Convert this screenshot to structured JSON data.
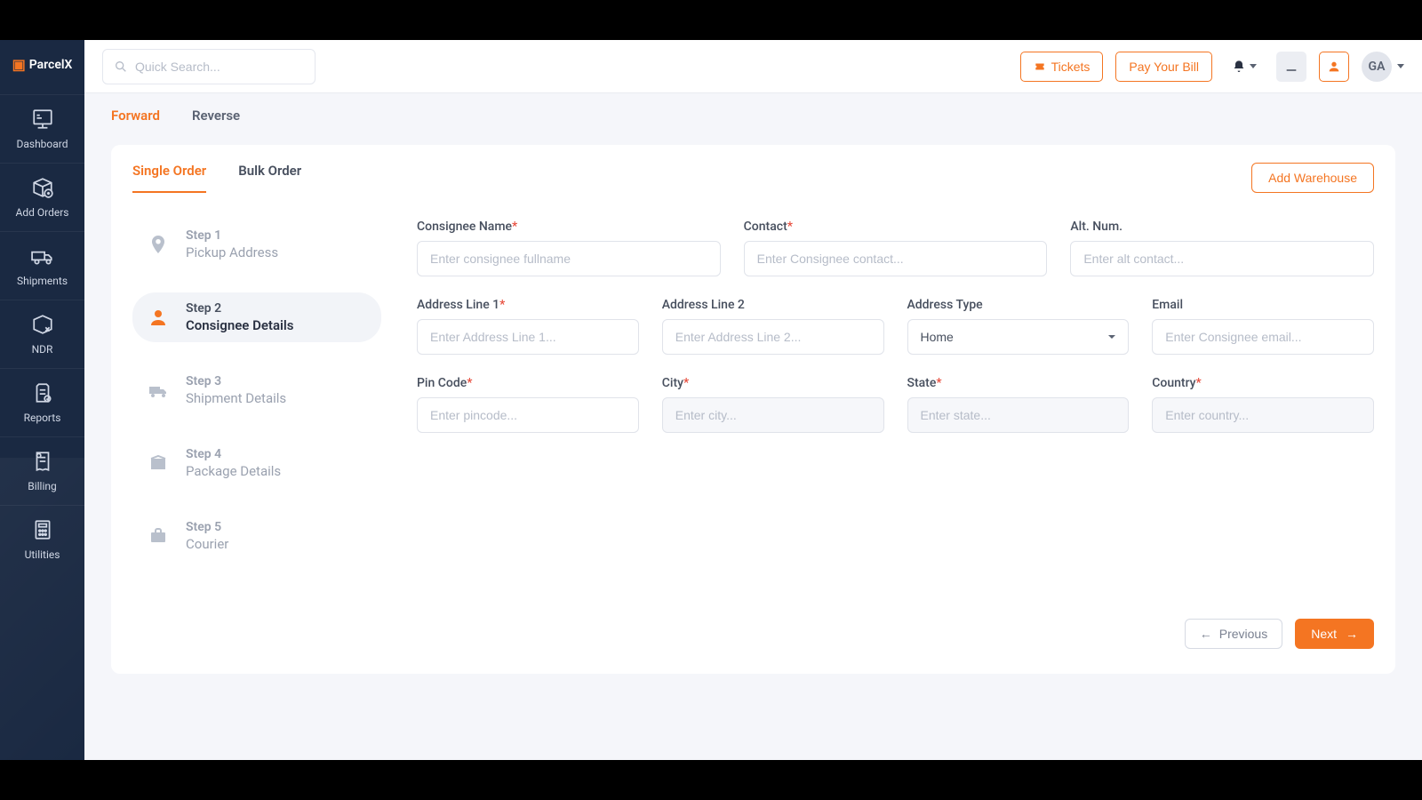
{
  "brand": {
    "name": "ParcelX"
  },
  "sidebar": {
    "items": [
      {
        "label": "Dashboard"
      },
      {
        "label": "Add Orders"
      },
      {
        "label": "Shipments"
      },
      {
        "label": "NDR"
      },
      {
        "label": "Reports"
      },
      {
        "label": "Billing"
      },
      {
        "label": "Utilities"
      }
    ]
  },
  "header": {
    "search_placeholder": "Quick Search...",
    "tickets": "Tickets",
    "pay_bill": "Pay Your Bill",
    "avatar_initials": "GA"
  },
  "tabs": {
    "forward": "Forward",
    "reverse": "Reverse"
  },
  "order_tabs": {
    "single": "Single Order",
    "bulk": "Bulk Order"
  },
  "add_warehouse": "Add Warehouse",
  "steps": [
    {
      "num": "Step 1",
      "label": "Pickup Address"
    },
    {
      "num": "Step 2",
      "label": "Consignee Details"
    },
    {
      "num": "Step 3",
      "label": "Shipment Details"
    },
    {
      "num": "Step 4",
      "label": "Package Details"
    },
    {
      "num": "Step 5",
      "label": "Courier"
    }
  ],
  "form": {
    "consignee_name": {
      "label": "Consignee Name",
      "placeholder": "Enter consignee fullname",
      "required": true
    },
    "contact": {
      "label": "Contact",
      "placeholder": "Enter Consignee contact...",
      "required": true
    },
    "alt_num": {
      "label": "Alt. Num.",
      "placeholder": "Enter alt contact...",
      "required": false
    },
    "address1": {
      "label": "Address Line 1",
      "placeholder": "Enter Address Line 1...",
      "required": true
    },
    "address2": {
      "label": "Address Line 2",
      "placeholder": "Enter Address Line 2...",
      "required": false
    },
    "address_type": {
      "label": "Address Type",
      "selected": "Home"
    },
    "email": {
      "label": "Email",
      "placeholder": "Enter Consignee email...",
      "required": false
    },
    "pincode": {
      "label": "Pin Code",
      "placeholder": "Enter pincode...",
      "required": true
    },
    "city": {
      "label": "City",
      "placeholder": "Enter city...",
      "required": true
    },
    "state": {
      "label": "State",
      "placeholder": "Enter state...",
      "required": true
    },
    "country": {
      "label": "Country",
      "placeholder": "Enter country...",
      "required": true
    }
  },
  "buttons": {
    "previous": "Previous",
    "next": "Next"
  }
}
